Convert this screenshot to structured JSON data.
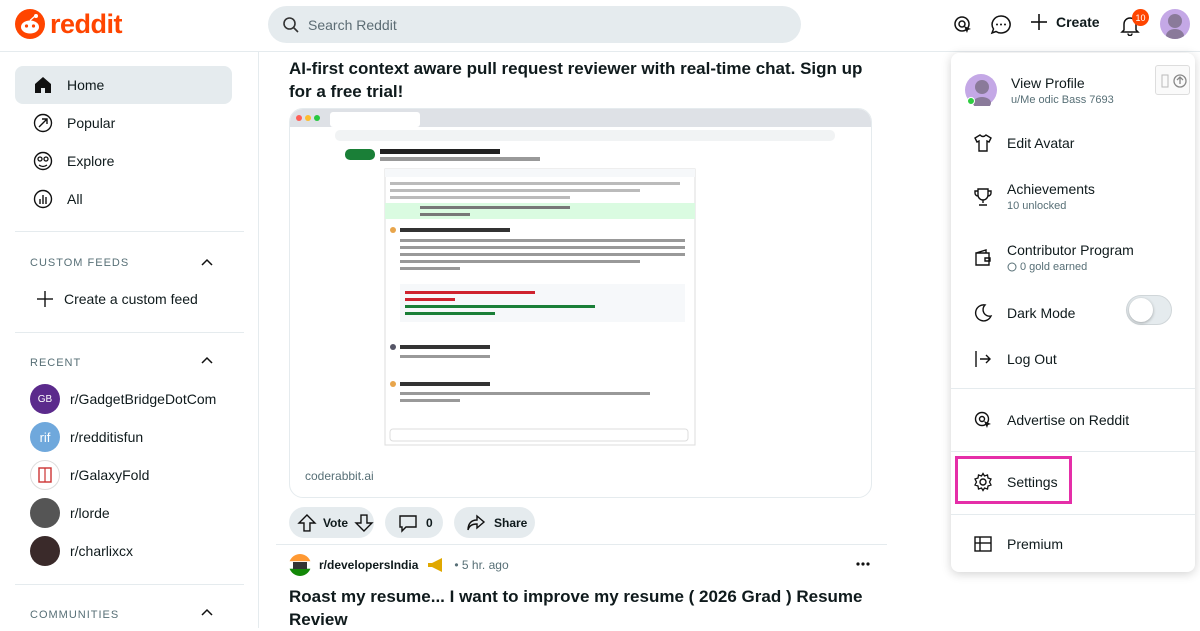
{
  "header": {
    "logo_text": "reddit",
    "search_placeholder": "Search Reddit",
    "create_label": "Create",
    "notification_count": "10",
    "accent": "#ff4500"
  },
  "sidebar": {
    "nav": [
      {
        "label": "Home",
        "icon": "home-icon"
      },
      {
        "label": "Popular",
        "icon": "popular-icon"
      },
      {
        "label": "Explore",
        "icon": "explore-icon"
      },
      {
        "label": "All",
        "icon": "all-icon"
      }
    ],
    "custom_feeds_title": "CUSTOM FEEDS",
    "create_feed_label": "Create a custom feed",
    "recent_title": "RECENT",
    "recent": [
      {
        "name": "r/GadgetBridgeDotCom",
        "color": "#5b2a8c"
      },
      {
        "name": "r/redditisfun",
        "color": "#6fa8dc"
      },
      {
        "name": "r/GalaxyFold",
        "color": "#ffffff"
      },
      {
        "name": "r/lorde",
        "color": "#555555"
      },
      {
        "name": "r/charlixcx",
        "color": "#3a2a2a"
      }
    ],
    "communities_title": "COMMUNITIES"
  },
  "post": {
    "title": "AI-first context aware pull request reviewer with real-time chat. Sign up for a free trial!",
    "link": "coderabbit.ai",
    "vote_label": "Vote",
    "comments": "0",
    "share_label": "Share"
  },
  "post2": {
    "subreddit": "r/developersIndia",
    "time": "• 5 hr. ago",
    "title": "Roast my resume... I want to improve my resume ( 2026 Grad ) Resume Review"
  },
  "menu": {
    "view_profile": "View Profile",
    "username": "u/Me odic Bass 7693",
    "edit_avatar": "Edit Avatar",
    "achievements": "Achievements",
    "achievements_sub": "10 unlocked",
    "contributor": "Contributor Program",
    "contributor_sub": "0 gold earned",
    "dark_mode": "Dark Mode",
    "log_out": "Log Out",
    "advertise": "Advertise on Reddit",
    "settings": "Settings",
    "premium": "Premium"
  }
}
